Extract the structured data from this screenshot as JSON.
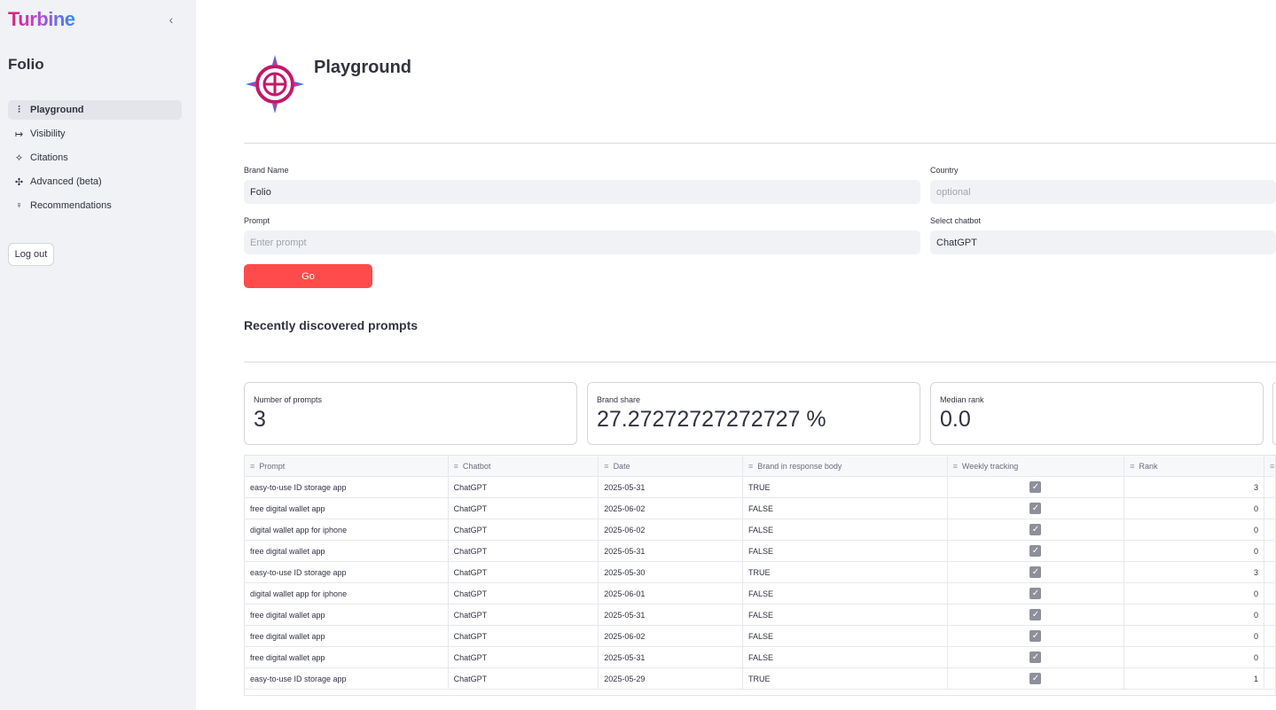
{
  "sidebar": {
    "logo": "Turbine",
    "title": "Folio",
    "items": [
      {
        "label": "Playground",
        "icon": "playground-icon",
        "glyph": "⫶"
      },
      {
        "label": "Visibility",
        "icon": "arrow-right-bar-icon",
        "glyph": "↦"
      },
      {
        "label": "Citations",
        "icon": "network-icon",
        "glyph": "⟡"
      },
      {
        "label": "Advanced (beta)",
        "icon": "sparkle-icon",
        "glyph": "✣"
      },
      {
        "label": "Recommendations",
        "icon": "lightbulb-icon",
        "glyph": "♀"
      }
    ],
    "logout": "Log out"
  },
  "main": {
    "title": "Playground",
    "form": {
      "brand_label": "Brand Name",
      "brand_value": "Folio",
      "country_label": "Country",
      "country_placeholder": "optional",
      "prompt_label": "Prompt",
      "prompt_placeholder": "Enter prompt",
      "chatbot_label": "Select chatbot",
      "chatbot_value": "ChatGPT",
      "go": "Go"
    },
    "section_title": "Recently discovered prompts",
    "metrics": [
      {
        "label": "Number of prompts",
        "value": "3"
      },
      {
        "label": "Brand share",
        "value": "27.27272727272727 %"
      },
      {
        "label": "Median rank",
        "value": "0.0"
      }
    ],
    "table": {
      "columns": [
        "Prompt",
        "Chatbot",
        "Date",
        "Brand in response body",
        "Weekly tracking",
        "Rank"
      ],
      "rows": [
        {
          "prompt": "easy-to-use ID storage app",
          "chatbot": "ChatGPT",
          "date": "2025-05-31",
          "brand": "TRUE",
          "rank": "3"
        },
        {
          "prompt": "free digital wallet app",
          "chatbot": "ChatGPT",
          "date": "2025-06-02",
          "brand": "FALSE",
          "rank": "0"
        },
        {
          "prompt": "digital wallet app for iphone",
          "chatbot": "ChatGPT",
          "date": "2025-06-02",
          "brand": "FALSE",
          "rank": "0"
        },
        {
          "prompt": "free digital wallet app",
          "chatbot": "ChatGPT",
          "date": "2025-05-31",
          "brand": "FALSE",
          "rank": "0"
        },
        {
          "prompt": "easy-to-use ID storage app",
          "chatbot": "ChatGPT",
          "date": "2025-05-30",
          "brand": "TRUE",
          "rank": "3"
        },
        {
          "prompt": "digital wallet app for iphone",
          "chatbot": "ChatGPT",
          "date": "2025-06-01",
          "brand": "FALSE",
          "rank": "0"
        },
        {
          "prompt": "free digital wallet app",
          "chatbot": "ChatGPT",
          "date": "2025-05-31",
          "brand": "FALSE",
          "rank": "0"
        },
        {
          "prompt": "free digital wallet app",
          "chatbot": "ChatGPT",
          "date": "2025-06-02",
          "brand": "FALSE",
          "rank": "0"
        },
        {
          "prompt": "free digital wallet app",
          "chatbot": "ChatGPT",
          "date": "2025-05-31",
          "brand": "FALSE",
          "rank": "0"
        },
        {
          "prompt": "easy-to-use ID storage app",
          "chatbot": "ChatGPT",
          "date": "2025-05-29",
          "brand": "TRUE",
          "rank": "1"
        }
      ]
    }
  },
  "colors": {
    "accent": "#ff4b4b",
    "sidebar_bg": "#f0f2f6"
  }
}
